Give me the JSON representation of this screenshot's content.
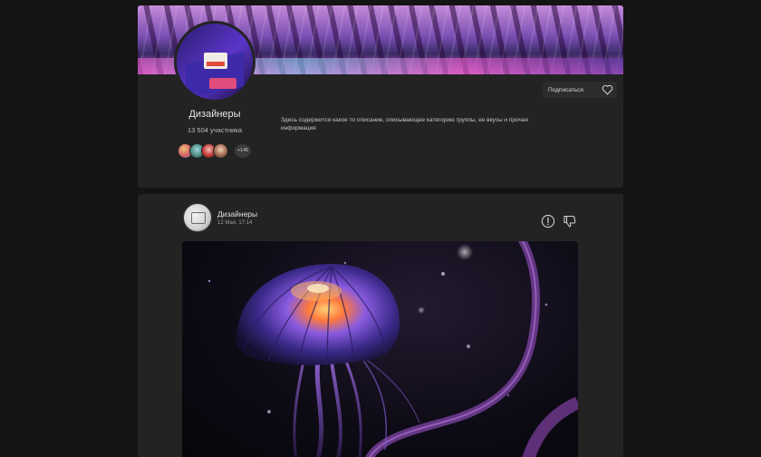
{
  "group": {
    "name": "Дизайнеры",
    "members_count": "13 504 участника",
    "extra_members_badge": "+145",
    "description": "Здесь содержится какое то описание, описывающее категорию группы, ее вкусы и прочая информация",
    "subscribe_label": "Подписаться"
  },
  "post": {
    "author": "Дизайнеры",
    "date": "12 Мая, 17:14"
  },
  "colors": {
    "background": "#141414",
    "card": "#232323",
    "button": "#2c2c2c",
    "jellyfish_accent": "#7a4fd8"
  },
  "icons": [
    "heart-icon",
    "report-icon",
    "dislike-icon"
  ]
}
